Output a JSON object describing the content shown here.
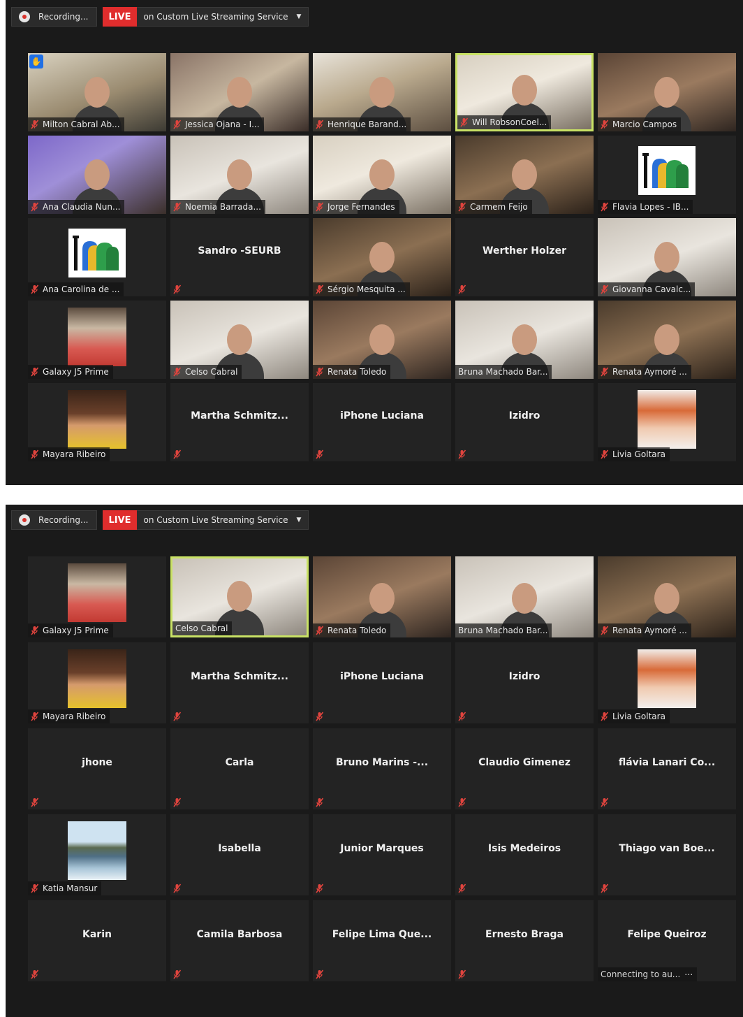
{
  "recording_label": "Recording...",
  "live_label": "LIVE",
  "service_label": "on Custom Live Streaming Service",
  "panels": [
    {
      "tiles": [
        {
          "name": "Milton Cabral Ab...",
          "type": "video",
          "color": "c0",
          "muted": true,
          "hand": true
        },
        {
          "name": "Jessica Ojana - I...",
          "type": "video",
          "color": "c1",
          "muted": true
        },
        {
          "name": "Henrique Barand...",
          "type": "video",
          "color": "c2",
          "muted": true
        },
        {
          "name": "Will RobsonCoel...",
          "type": "video",
          "color": "c5",
          "muted": true,
          "speaker": true
        },
        {
          "name": "Marcio Campos",
          "type": "video",
          "color": "c4",
          "muted": true
        },
        {
          "name": "Ana Claudia Nun...",
          "type": "video",
          "color": "c3",
          "muted": true
        },
        {
          "name": "Noemia Barrada...",
          "type": "video",
          "color": "c6",
          "muted": true
        },
        {
          "name": "Jorge Fernandes",
          "type": "video",
          "color": "c5",
          "muted": true
        },
        {
          "name": "Carmem Feijo",
          "type": "video",
          "color": "c7",
          "muted": true
        },
        {
          "name": "Flavia Lopes - IB...",
          "type": "pic",
          "pic": "logo",
          "muted": true
        },
        {
          "name": "Ana Carolina de ...",
          "type": "pic",
          "pic": "logo",
          "muted": true
        },
        {
          "name": "Sandro -SEURB",
          "type": "text",
          "muted": true
        },
        {
          "name": "Sérgio Mesquita ...",
          "type": "video",
          "color": "c7",
          "muted": true
        },
        {
          "name": "Werther Holzer",
          "type": "text",
          "muted": true
        },
        {
          "name": "Giovanna Cavalc...",
          "type": "video",
          "color": "c6",
          "muted": true
        },
        {
          "name": "Galaxy J5 Prime",
          "type": "pic",
          "pic": "man",
          "muted": true
        },
        {
          "name": "Celso Cabral",
          "type": "video",
          "color": "c6",
          "muted": true
        },
        {
          "name": "Renata Toledo",
          "type": "video",
          "color": "c4",
          "muted": true
        },
        {
          "name": "Bruna Machado Bar...",
          "type": "video",
          "color": "c6",
          "muted": false
        },
        {
          "name": "Renata Aymoré ...",
          "type": "video",
          "color": "c7",
          "muted": true
        },
        {
          "name": "Mayara Ribeiro",
          "type": "pic",
          "pic": "lady",
          "muted": true
        },
        {
          "name": "Martha  Schmitz...",
          "type": "text",
          "muted": true
        },
        {
          "name": "iPhone Luciana",
          "type": "text",
          "muted": true
        },
        {
          "name": "Izidro",
          "type": "text",
          "muted": true
        },
        {
          "name": "Livia Goltara",
          "type": "pic",
          "pic": "red",
          "muted": true
        }
      ]
    },
    {
      "tiles": [
        {
          "name": "Galaxy J5 Prime",
          "type": "pic",
          "pic": "man",
          "muted": true
        },
        {
          "name": "Celso Cabral",
          "type": "video",
          "color": "c6",
          "muted": false,
          "speaker": true
        },
        {
          "name": "Renata Toledo",
          "type": "video",
          "color": "c4",
          "muted": true
        },
        {
          "name": "Bruna Machado Bar...",
          "type": "video",
          "color": "c6",
          "muted": false
        },
        {
          "name": "Renata Aymoré ...",
          "type": "video",
          "color": "c7",
          "muted": true
        },
        {
          "name": "Mayara Ribeiro",
          "type": "pic",
          "pic": "lady",
          "muted": true
        },
        {
          "name": "Martha  Schmitz...",
          "type": "text",
          "muted": true
        },
        {
          "name": "iPhone Luciana",
          "type": "text",
          "muted": true
        },
        {
          "name": "Izidro",
          "type": "text",
          "muted": true
        },
        {
          "name": "Livia Goltara",
          "type": "pic",
          "pic": "red",
          "muted": true
        },
        {
          "name": "jhone",
          "type": "text",
          "muted": true
        },
        {
          "name": "Carla",
          "type": "text",
          "muted": true
        },
        {
          "name": "Bruno Marins -...",
          "type": "text",
          "muted": true
        },
        {
          "name": "Claudio Gimenez",
          "type": "text",
          "muted": true
        },
        {
          "name": "flávia Lanari Co...",
          "type": "text",
          "muted": true
        },
        {
          "name": "Katia Mansur",
          "type": "pic",
          "pic": "sea",
          "muted": true
        },
        {
          "name": "Isabella",
          "type": "text",
          "muted": true
        },
        {
          "name": "Junior Marques",
          "type": "text",
          "muted": true
        },
        {
          "name": "Isis Medeiros",
          "type": "text",
          "muted": true
        },
        {
          "name": "Thiago van Boe...",
          "type": "text",
          "muted": true
        },
        {
          "name": "Karin",
          "type": "text",
          "muted": true
        },
        {
          "name": "Camila Barbosa",
          "type": "text",
          "muted": true
        },
        {
          "name": "Felipe Lima  Que...",
          "type": "text",
          "muted": true
        },
        {
          "name": "Ernesto Braga",
          "type": "text",
          "muted": true
        },
        {
          "name": "Felipe Queiroz",
          "type": "text",
          "muted": false,
          "status": "Connecting to au..."
        }
      ]
    }
  ],
  "colors": {
    "speaker_border": "#c9e265",
    "live": "#e02d2d",
    "muted_icon": "#e0443e",
    "hand": "#1f6fe5"
  },
  "icons": {
    "muted": "muted-mic-icon",
    "hand": "raised-hand-icon",
    "record": "record-icon"
  }
}
